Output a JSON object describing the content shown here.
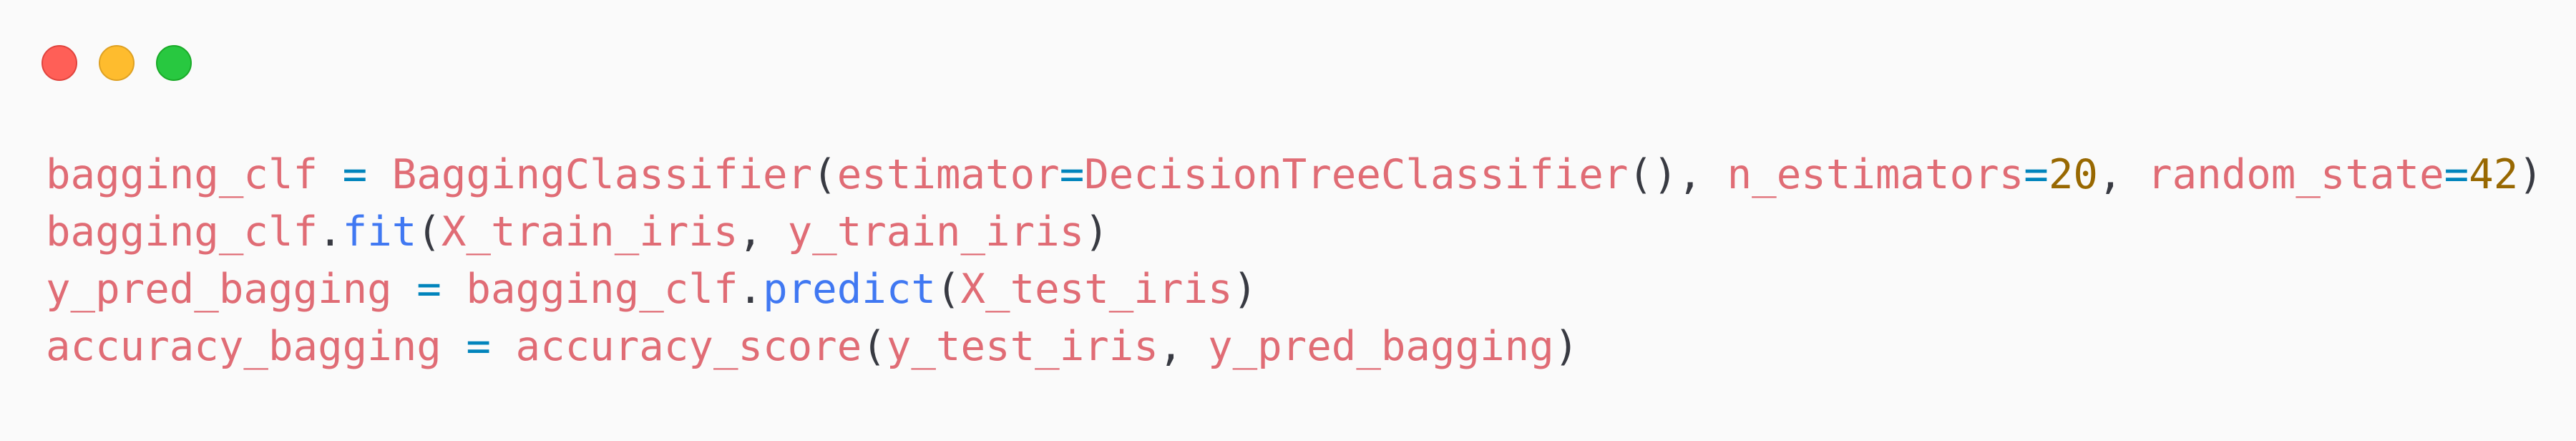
{
  "window": {
    "controls": [
      "close-button",
      "minimize-button",
      "zoom-button"
    ]
  },
  "code": {
    "line1": {
      "t1": "bagging_clf",
      "t2": " ",
      "t3": "=",
      "t4": " ",
      "t5": "BaggingClassifier",
      "t6": "(",
      "t7": "estimator",
      "t8": "=",
      "t9": "DecisionTreeClassifier",
      "t10": "()",
      "t11": ", ",
      "t12": "n_estimators",
      "t13": "=",
      "t14": "20",
      "t15": ", ",
      "t16": "random_state",
      "t17": "=",
      "t18": "42",
      "t19": ")"
    },
    "line2": {
      "t1": "bagging_clf",
      "t2": ".",
      "t3": "fit",
      "t4": "(",
      "t5": "X_train_iris",
      "t6": ", ",
      "t7": "y_train_iris",
      "t8": ")"
    },
    "line3": {
      "t1": "y_pred_bagging",
      "t2": " ",
      "t3": "=",
      "t4": " ",
      "t5": "bagging_clf",
      "t6": ".",
      "t7": "predict",
      "t8": "(",
      "t9": "X_test_iris",
      "t10": ")"
    },
    "line4": {
      "t1": "accuracy_bagging",
      "t2": " ",
      "t3": "=",
      "t4": " ",
      "t5": "accuracy_score",
      "t6": "(",
      "t7": "y_test_iris",
      "t8": ", ",
      "t9": "y_pred_bagging",
      "t10": ")"
    }
  },
  "colors": {
    "background": "#fafafa",
    "variable": "#e06c75",
    "operator": "#0184bc",
    "function": "#4078f2",
    "number": "#986801",
    "punctuation": "#383a42",
    "close": "#ff5f57",
    "minimize": "#febc2e",
    "zoom": "#28c840"
  }
}
